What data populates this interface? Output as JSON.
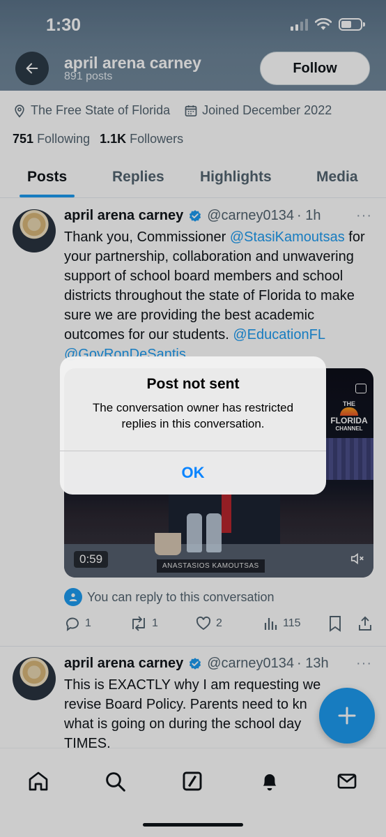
{
  "status_bar": {
    "time": "1:30"
  },
  "header": {
    "name": "april arena carney",
    "posts_count": "891 posts",
    "follow_label": "Follow"
  },
  "profile": {
    "location": "The Free State of Florida",
    "joined": "Joined December 2022",
    "following_count": "751",
    "following_label": "Following",
    "followers_count": "1.1K",
    "followers_label": "Followers"
  },
  "tabs": [
    {
      "label": "Posts",
      "active": true
    },
    {
      "label": "Replies",
      "active": false
    },
    {
      "label": "Highlights",
      "active": false
    },
    {
      "label": "Media",
      "active": false
    }
  ],
  "tweets": [
    {
      "name": "april arena carney",
      "handle": "@carney0134",
      "time": "· 1h",
      "more": "···",
      "text_1": "Thank you, Commissioner ",
      "mention_1": "@StasiKamoutsas",
      "text_2": " for your partnership, collaboration and unwavering support of school board members and school districts throughout the state of Florida to make sure we are providing the best academic outcomes for our students.",
      "mention_2": "@EducationFL",
      "mention_3": "@GovRonDeSantis",
      "video": {
        "duration": "0:59",
        "nameplate": "ANASTASIOS KAMOUTSAS",
        "channel_logo_top": "THE",
        "channel_logo_main": "FLORIDA",
        "channel_logo_sub": "CHANNEL"
      },
      "reply_note": "You can reply to this conversation",
      "stats": {
        "replies": "1",
        "reposts": "1",
        "likes": "2",
        "views": "115"
      }
    },
    {
      "name": "april arena carney",
      "handle": "@carney0134",
      "time": "· 13h",
      "more": "···",
      "text": "This is EXACTLY why I am requesting we revise Board Policy. Parents need to kn what is going on during the school day TIMES."
    }
  ],
  "alert": {
    "title": "Post not sent",
    "message": "The conversation owner has restricted replies in this conversation.",
    "ok_label": "OK"
  },
  "icons": {
    "back": "arrow-left-icon",
    "location": "location-pin-icon",
    "calendar": "calendar-icon",
    "verified": "verified-badge-icon",
    "reply": "reply-icon",
    "repost": "repost-icon",
    "like": "heart-icon",
    "views": "views-icon",
    "bookmark": "bookmark-icon",
    "share": "share-icon",
    "compose": "plus-icon",
    "nav": [
      "home-icon",
      "search-icon",
      "grok-icon",
      "notifications-icon",
      "messages-icon"
    ]
  },
  "colors": {
    "accent": "#1d9bf0",
    "banner": "#6c8498",
    "alert_button": "#0a84ff"
  }
}
